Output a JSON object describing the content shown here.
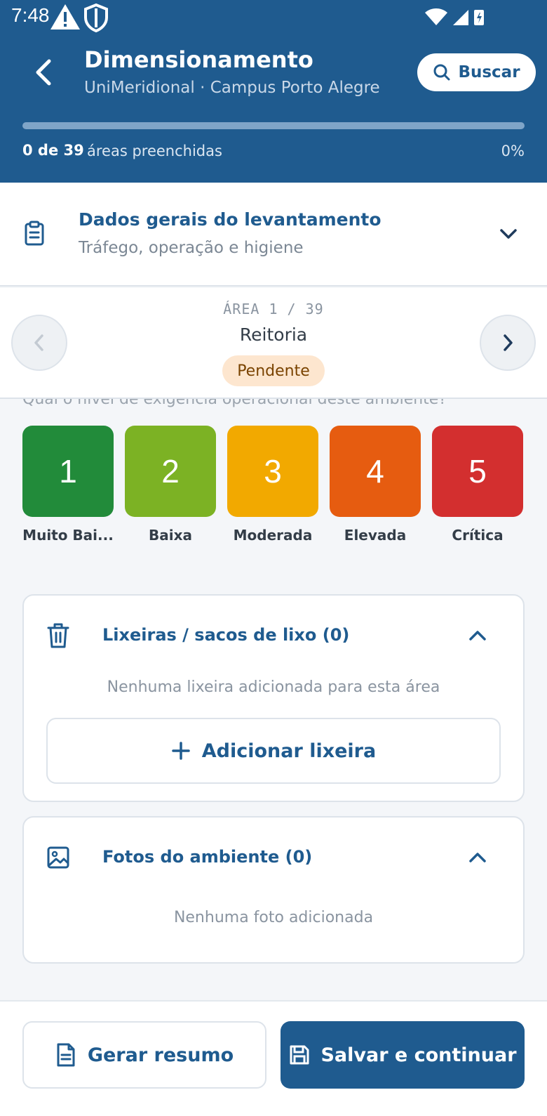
{
  "status_bar": {
    "time": "7:48"
  },
  "header": {
    "title": "Dimensionamento",
    "subtitle": "UniMeridional · Campus Porto Alegre",
    "search_label": "Buscar",
    "progress": {
      "count_text": "0 de 39",
      "suffix_text": "áreas preenchidas",
      "percent_text": "0%",
      "fraction": 0
    }
  },
  "general_section": {
    "title": "Dados gerais do levantamento",
    "subtitle": "Tráfego, operação e higiene",
    "icon": "clipboard-icon"
  },
  "area_nav": {
    "counter": "ÁREA 1 / 39",
    "name": "Reitoria",
    "status": "Pendente"
  },
  "question": "Qual o nível de exigência operacional deste ambiente?",
  "levels": [
    {
      "value": "1",
      "label": "Muito Bai...",
      "color": "#228b3a"
    },
    {
      "value": "2",
      "label": "Baixa",
      "color": "#7cb224"
    },
    {
      "value": "3",
      "label": "Moderada",
      "color": "#f2a900"
    },
    {
      "value": "4",
      "label": "Elevada",
      "color": "#e65c10"
    },
    {
      "value": "5",
      "label": "Crítica",
      "color": "#d32f2f"
    }
  ],
  "bins_section": {
    "title": "Lixeiras / sacos de lixo (0)",
    "empty_text": "Nenhuma lixeira adicionada para esta área",
    "add_label": "Adicionar lixeira",
    "icon": "trash-icon"
  },
  "photos_section": {
    "title": "Fotos do ambiente (0)",
    "empty_text": "Nenhuma foto adicionada",
    "icon": "image-icon"
  },
  "footer": {
    "summary_label": "Gerar resumo",
    "save_label": "Salvar e continuar"
  },
  "colors": {
    "primary": "#1f5b8f",
    "pending_badge_bg": "#fde6cf",
    "pending_badge_text": "#7a4300"
  }
}
